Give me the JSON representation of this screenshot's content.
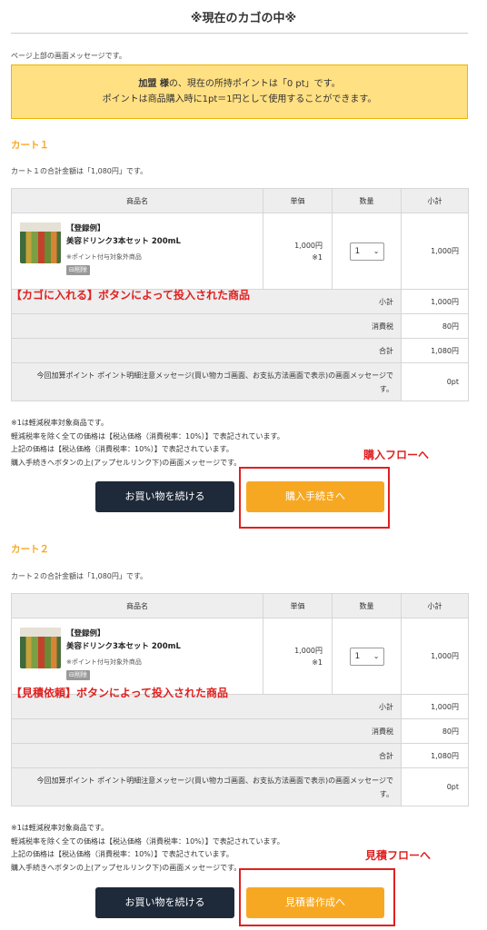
{
  "page_title": "※現在のカゴの中※",
  "header_message": "ページ上部の画面メッセージです。",
  "notice": {
    "line1_name": "加盟 様",
    "line1_rest": "の、現在の所持ポイントは「0 pt」です。",
    "line2": "ポイントは商品購入時に1pt＝1円として使用することができます。"
  },
  "table_headers": [
    "商品名",
    "単価",
    "数量",
    "小計"
  ],
  "carts": [
    {
      "heading": "カート１",
      "total_message": "カート１の合計金額は「1,080円」です。",
      "product": {
        "tag": "【登録例】",
        "name": "美容ドリンク3本セット 200mL",
        "note": "※ポイント付与対象外商品",
        "delete_label": "削除",
        "unit_price": "1,000円",
        "price_note": "※1",
        "qty": "1",
        "line_total": "1,000円"
      },
      "summary": [
        {
          "label": "小計",
          "value": "1,000円"
        },
        {
          "label": "消費税",
          "value": "80円"
        },
        {
          "label": "合計",
          "value": "1,080円"
        }
      ],
      "points_label": "今回加算ポイント ポイント明細注意メッセージ(買い物カゴ画面、お支払方法画面で表示)の画面メッセージです。",
      "points_value": "0pt",
      "notes": [
        "※1は軽減税率対象商品です。",
        "軽減税率を除く全ての価格は【税込価格（消費税率：10%）】で表記されています。",
        "上記の価格は【税込価格（消費税率：10%）】で表記されています。",
        "購入手続きへボタンの上(アップセルリンク下)の画面メッセージです。"
      ],
      "continue_label": "お買い物を続ける",
      "action_label": "購入手続きへ",
      "annotation_product": "【カゴに入れる】ボタンによって投入された商品",
      "annotation_flow": "購入フローへ"
    },
    {
      "heading": "カート２",
      "total_message": "カート２の合計金額は「1,080円」です。",
      "product": {
        "tag": "【登録例】",
        "name": "美容ドリンク3本セット 200mL",
        "note": "※ポイント付与対象外商品",
        "delete_label": "削除",
        "unit_price": "1,000円",
        "price_note": "※1",
        "qty": "1",
        "line_total": "1,000円"
      },
      "summary": [
        {
          "label": "小計",
          "value": "1,000円"
        },
        {
          "label": "消費税",
          "value": "80円"
        },
        {
          "label": "合計",
          "value": "1,080円"
        }
      ],
      "points_label": "今回加算ポイント ポイント明細注意メッセージ(買い物カゴ画面、お支払方法画面で表示)の画面メッセージです。",
      "points_value": "0pt",
      "notes": [
        "※1は軽減税率対象商品です。",
        "軽減税率を除く全ての価格は【税込価格（消費税率：10%）】で表記されています。",
        "上記の価格は【税込価格（消費税率：10%）】で表記されています。",
        "購入手続きへボタンの上(アップセルリンク下)の画面メッセージです。"
      ],
      "continue_label": "お買い物を続ける",
      "action_label": "見積書作成へ",
      "annotation_product": "【見積依頼】ボタンによって投入された商品",
      "annotation_flow": "見積フローへ"
    }
  ],
  "colors": {
    "accent": "#f7a823",
    "dark_button": "#1e2a3a",
    "notice_bg": "#ffe082",
    "annotation_red": "#e02020"
  }
}
